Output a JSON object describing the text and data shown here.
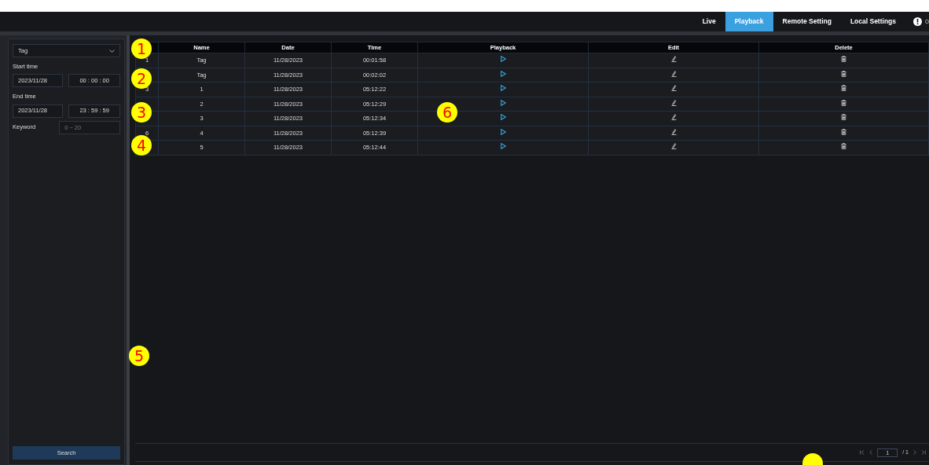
{
  "nav": {
    "tabs": [
      {
        "label": "Live",
        "selected": false
      },
      {
        "label": "Playback",
        "selected": true
      },
      {
        "label": "Remote Setting",
        "selected": false
      },
      {
        "label": "Local Settings",
        "selected": false
      }
    ]
  },
  "filter": {
    "type": "Tag",
    "start_label": "Start time",
    "start_date": "2023/11/28",
    "start_time": "00  :  00  :  00",
    "end_label": "End time",
    "end_date": "2023/11/28",
    "end_time": "23  :  59  :  59",
    "keyword_label": "Keyword",
    "keyword_placeholder": "0 ~ 20",
    "search_button": "Search"
  },
  "table": {
    "columns": [
      "Name",
      "Date",
      "Time",
      "Playback",
      "Edit",
      "Delete"
    ],
    "rows": [
      {
        "index": "1",
        "name": "Tag",
        "date": "11/28/2023",
        "time": "00:01:58"
      },
      {
        "name": "Tag",
        "date": "11/28/2023",
        "time": "00:02:02"
      },
      {
        "index": "3",
        "name": "1",
        "date": "11/28/2023",
        "time": "05:12:22"
      },
      {
        "name": "2",
        "date": "11/28/2023",
        "time": "05:12:29"
      },
      {
        "name": "3",
        "date": "11/28/2023",
        "time": "05:12:34"
      },
      {
        "index": "6",
        "name": "4",
        "date": "11/28/2023",
        "time": "05:12:39"
      },
      {
        "name": "5",
        "date": "11/28/2023",
        "time": "05:12:44"
      }
    ]
  },
  "pagination": {
    "page": "1",
    "total": "/ 1"
  },
  "callouts": [
    {
      "label": "1",
      "cut": false
    },
    {
      "label": "2",
      "cut": false
    },
    {
      "label": "3",
      "cut": false
    },
    {
      "label": "4",
      "cut": false
    },
    {
      "label": "5",
      "cut": false
    },
    {
      "label": "6",
      "cut": false
    },
    {
      "cut": true
    }
  ]
}
